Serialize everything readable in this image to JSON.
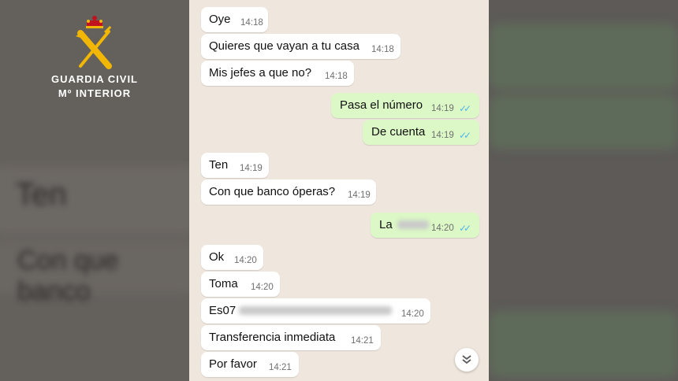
{
  "branding": {
    "line1": "GUARDIA CIVIL",
    "line2": "Mº INTERIOR"
  },
  "chat": {
    "messages": [
      {
        "dir": "in",
        "text": "Oye",
        "time": "14:18"
      },
      {
        "dir": "in",
        "text": "Quieres que vayan a tu casa",
        "time": "14:18"
      },
      {
        "dir": "in",
        "text": "Mis jefes a que no?",
        "time": "14:18"
      },
      {
        "dir": "out",
        "text": "Pasa el número",
        "time": "14:19",
        "read": true
      },
      {
        "dir": "out",
        "text": "De cuenta",
        "time": "14:19",
        "read": true
      },
      {
        "dir": "in",
        "text": "Ten",
        "time": "14:19"
      },
      {
        "dir": "in",
        "text": "Con que banco óperas?",
        "time": "14:19"
      },
      {
        "dir": "out",
        "text": "La",
        "time": "14:20",
        "read": true,
        "redacted": true
      },
      {
        "dir": "in",
        "text": "Ok",
        "time": "14:20"
      },
      {
        "dir": "in",
        "text": "Toma",
        "time": "14:20"
      },
      {
        "dir": "in",
        "text": "Es07",
        "time": "14:20",
        "redacted": true
      },
      {
        "dir": "in",
        "text": "Transferencia inmediata",
        "time": "14:21"
      },
      {
        "dir": "in",
        "text": "Por favor",
        "time": "14:21"
      }
    ],
    "scroll_button_icon": "double-chevron-down-icon"
  },
  "colors": {
    "incoming_bubble": "#ffffff",
    "outgoing_bubble": "#dcf8c6",
    "read_ticks": "#4fb6ec",
    "chat_background": "#efe7de"
  }
}
